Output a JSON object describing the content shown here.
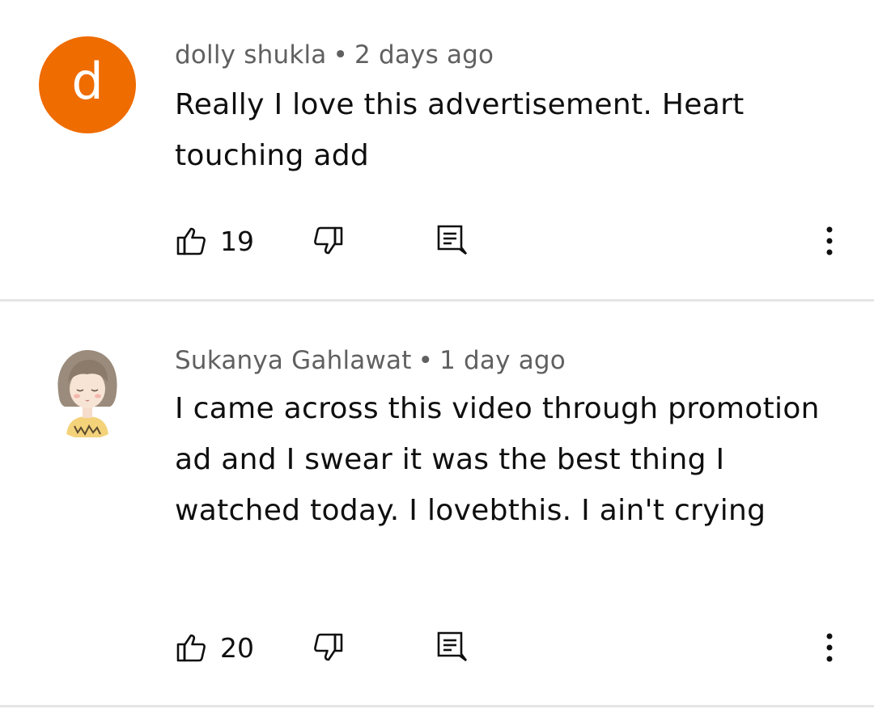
{
  "comments": [
    {
      "author": "dolly shukla",
      "separator": "•",
      "time": "2 days ago",
      "text": "Really I love this advertisement. Heart touching add",
      "likes": "19",
      "avatar": {
        "type": "letter",
        "letter": "d",
        "color": "#ef6c00"
      }
    },
    {
      "author": "Sukanya Gahlawat",
      "separator": "•",
      "time": "1 day ago",
      "text": "I came across this video through promotion ad and I swear it was the best thing I watched today. I lovebthis. I ain't crying",
      "likes": "20",
      "avatar": {
        "type": "illustration",
        "description_icon": "girl-avatar-icon"
      }
    }
  ],
  "icons": {
    "like": "thumb-up-icon",
    "dislike": "thumb-down-icon",
    "reply": "reply-comment-icon",
    "more": "more-vertical-icon"
  },
  "colors": {
    "text_primary": "#0f0f0f",
    "text_secondary": "#606060",
    "divider": "#e5e5e5",
    "avatar_orange": "#ef6c00"
  }
}
